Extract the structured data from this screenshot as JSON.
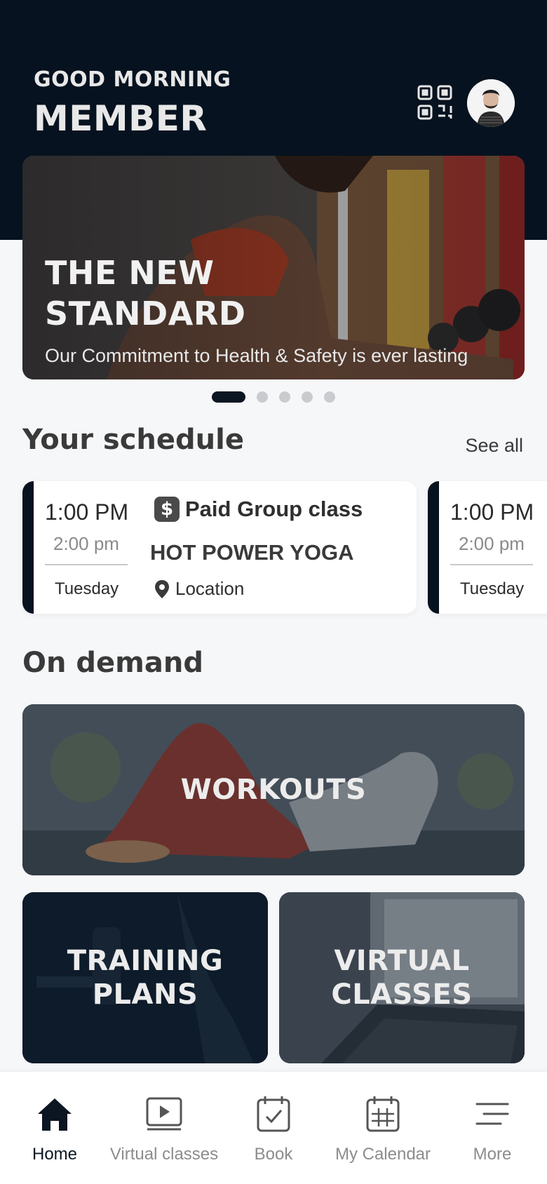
{
  "header": {
    "greeting": "GOOD MORNING",
    "member_name": "MEMBER",
    "qr_icon": "qr-code-icon",
    "avatar_icon": "profile-avatar"
  },
  "hero": {
    "title_line1": "THE NEW",
    "title_line2": "STANDARD",
    "subtitle": "Our Commitment to Health & Safety is ever lasting",
    "slides_total": 5,
    "active_slide": 1
  },
  "schedule": {
    "title": "Your schedule",
    "see_all_label": "See all",
    "cards": [
      {
        "start": "1:00 PM",
        "end": "2:00 pm",
        "day": "Tuesday",
        "badge_symbol": "$",
        "type": "Paid Group class",
        "name": "HOT POWER YOGA",
        "location": "Location"
      },
      {
        "start": "1:00 PM",
        "end": "2:00 pm",
        "day": "Tuesday"
      }
    ]
  },
  "on_demand": {
    "title": "On demand",
    "workouts_label": "WORKOUTS",
    "training_line1": "TRAINING",
    "training_line2": "PLANS",
    "virtual_line1": "VIRTUAL",
    "virtual_line2": "CLASSES"
  },
  "bottom_nav": {
    "items": [
      {
        "label": "Home",
        "icon": "home-icon",
        "active": true
      },
      {
        "label": "Virtual classes",
        "icon": "play-icon",
        "active": false
      },
      {
        "label": "Book",
        "icon": "calendar-check-icon",
        "active": false
      },
      {
        "label": "My Calendar",
        "icon": "calendar-grid-icon",
        "active": false
      },
      {
        "label": "More",
        "icon": "menu-icon",
        "active": false
      }
    ]
  },
  "colors": {
    "brand_dark": "#06121f",
    "background": "#f6f7f9",
    "nav_active": "#0b1622",
    "nav_inactive": "#8c8c8c"
  }
}
